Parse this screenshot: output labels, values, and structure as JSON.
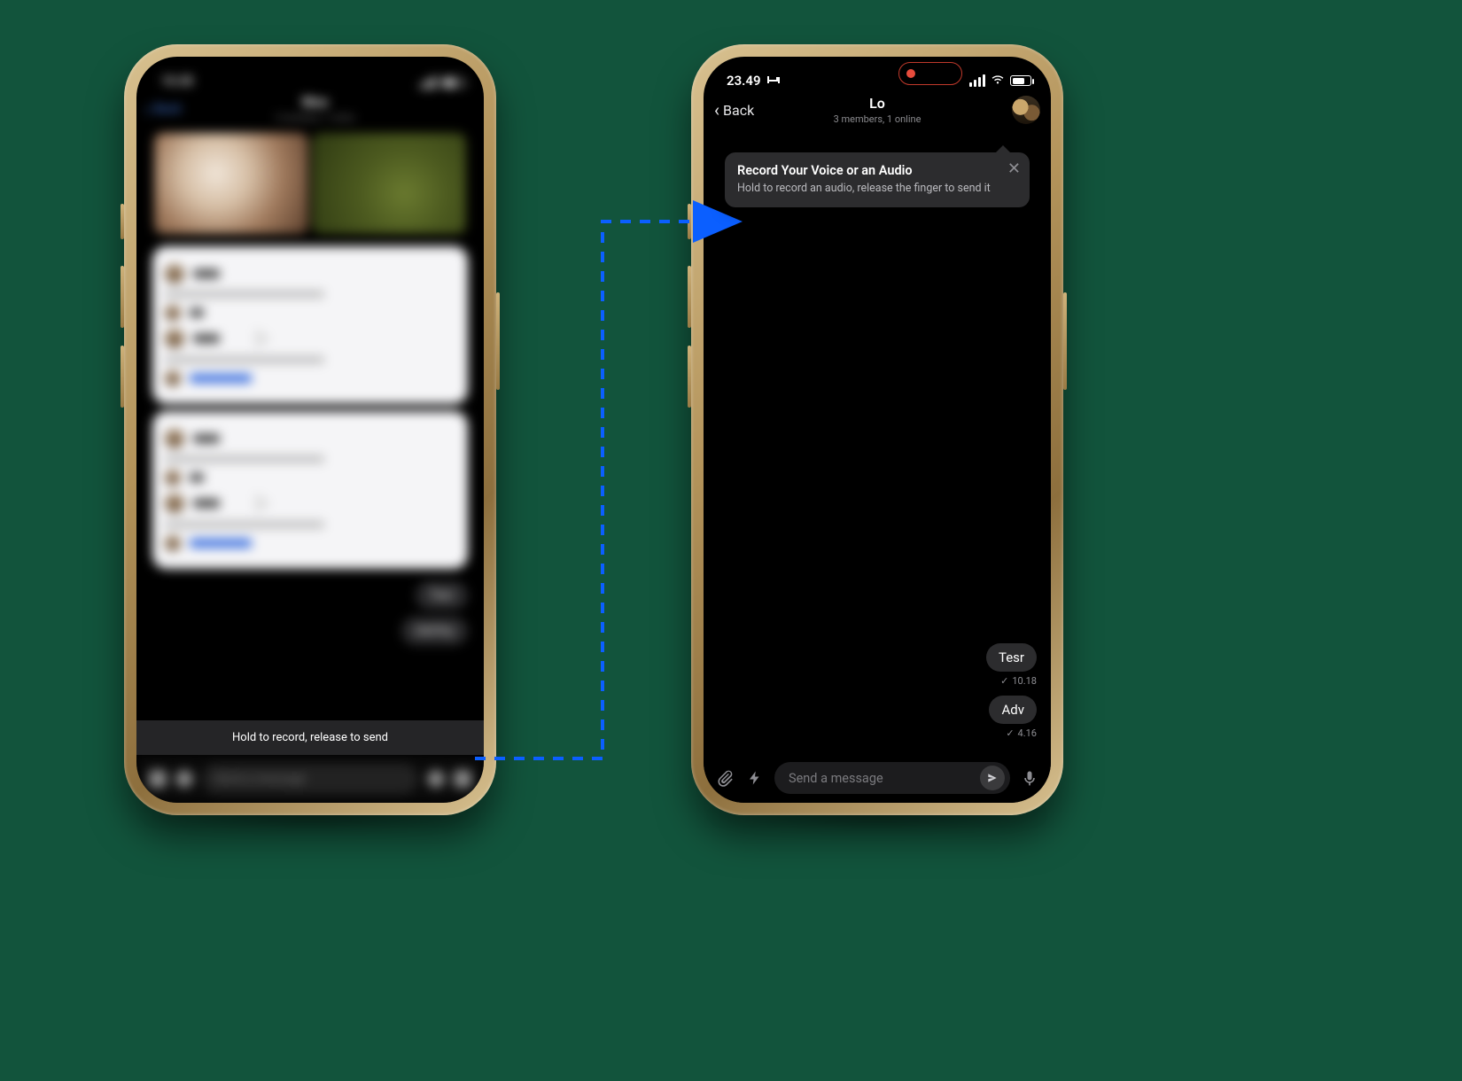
{
  "left": {
    "status_time": "15.35",
    "back_label": "Back",
    "header_title": "Woo",
    "header_sub": "3 members, 1 online",
    "toast_text": "Hold to record, release to send",
    "input_placeholder": "Send a message",
    "bubble1": "Tesr",
    "bubble2": "Advfny"
  },
  "right": {
    "status_time": "23.49",
    "back_label": "Back",
    "header_title": "Lo",
    "header_sub": "3 members, 1 online",
    "tooltip_title": "Record Your Voice or an Audio",
    "tooltip_body": "Hold to record an audio, release the finger to send it",
    "messages": [
      {
        "text": "Tesr",
        "time": "10.18"
      },
      {
        "text": "Adv",
        "time": "4.16"
      }
    ],
    "input_placeholder": "Send a message"
  },
  "connector_color": "#0b5fff"
}
